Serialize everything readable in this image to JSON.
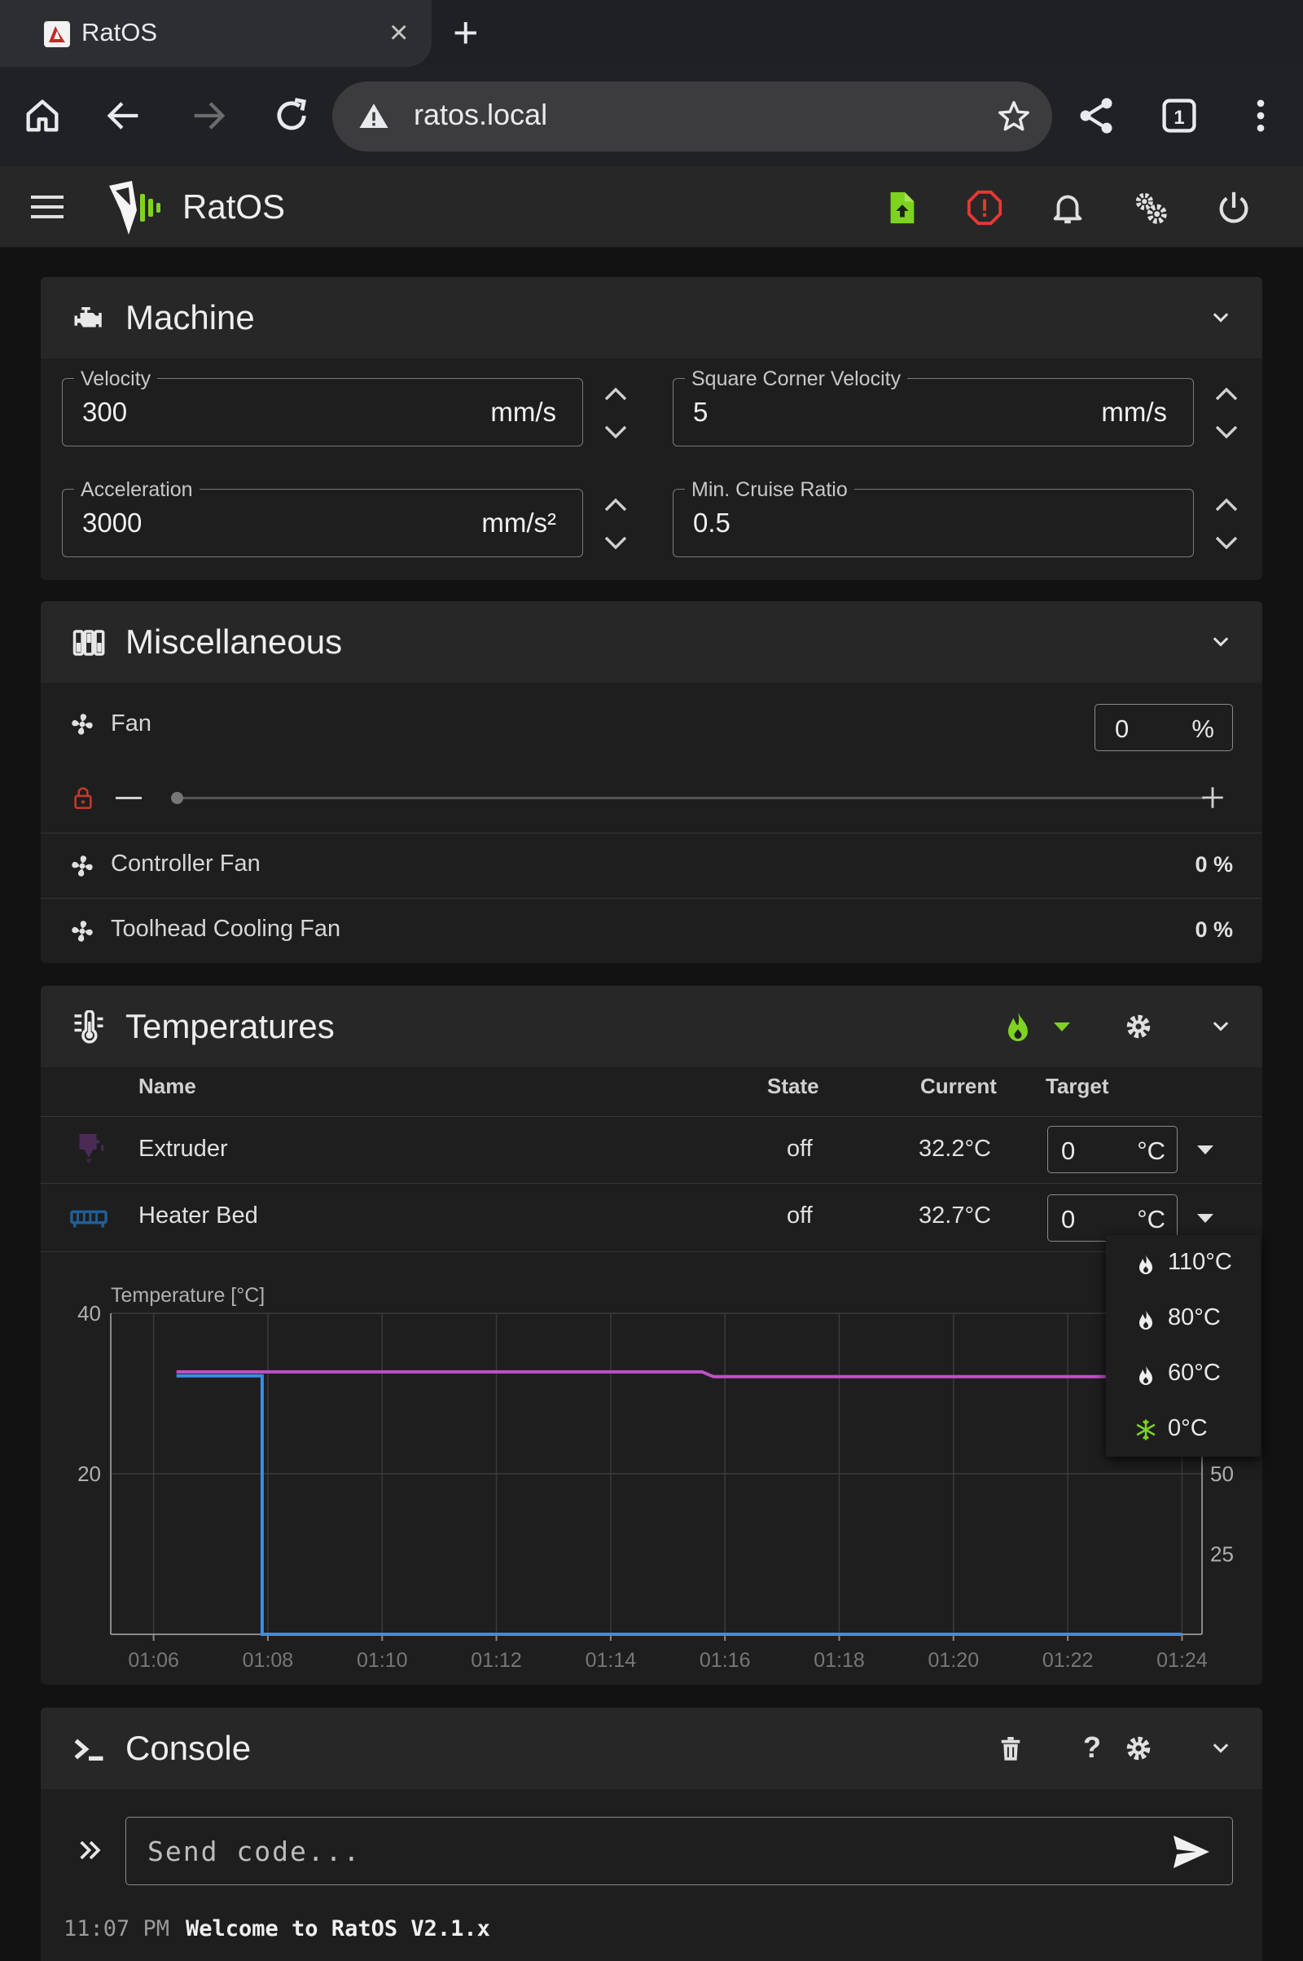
{
  "browser": {
    "tab_title": "RatOS",
    "url": "ratos.local"
  },
  "app": {
    "title": "RatOS",
    "colors": {
      "accent": "#7ed321",
      "error": "#e53935",
      "background": "#121212"
    }
  },
  "machine": {
    "title": "Machine",
    "fields": [
      {
        "label": "Velocity",
        "value": "300",
        "unit": "mm/s"
      },
      {
        "label": "Square Corner Velocity",
        "value": "5",
        "unit": "mm/s"
      },
      {
        "label": "Acceleration",
        "value": "3000",
        "unit": "mm/s²"
      },
      {
        "label": "Min. Cruise Ratio",
        "value": "0.5",
        "unit": ""
      }
    ]
  },
  "misc": {
    "title": "Miscellaneous",
    "fan": {
      "label": "Fan",
      "value": "0",
      "unit": "%",
      "level": 0
    },
    "rows": [
      {
        "label": "Controller Fan",
        "value": "0 %"
      },
      {
        "label": "Toolhead Cooling Fan",
        "value": "0 %"
      }
    ]
  },
  "temps": {
    "title": "Temperatures",
    "headers": {
      "name": "Name",
      "state": "State",
      "current": "Current",
      "target": "Target"
    },
    "rows": [
      {
        "name": "Extruder",
        "state": "off",
        "current": "32.2°C",
        "target": "0",
        "unit": "°C"
      },
      {
        "name": "Heater Bed",
        "state": "off",
        "current": "32.7°C",
        "target": "0",
        "unit": "°C"
      }
    ],
    "presets": [
      "110°C",
      "80°C",
      "60°C",
      "0°C"
    ]
  },
  "chart_data": {
    "type": "line",
    "ylabel": "Temperature [°C]",
    "x": [
      "01:06",
      "01:08",
      "01:10",
      "01:12",
      "01:14",
      "01:16",
      "01:18",
      "01:20",
      "01:22",
      "01:24"
    ],
    "y_ticks_left": [
      20,
      40
    ],
    "y_ticks_right": [
      25,
      50
    ],
    "ylim": [
      0,
      40
    ],
    "y2lim": [
      0,
      100
    ],
    "grid": true,
    "series": [
      {
        "color": "#c050c8",
        "points": [
          [
            "01:06.4",
            32.7
          ],
          [
            "01:15.6",
            32.7
          ],
          [
            "01:15.8",
            32.1
          ],
          [
            "01:24.0",
            32.1
          ]
        ]
      },
      {
        "color": "#3a8ee6",
        "points": [
          [
            "01:06.4",
            32.2
          ],
          [
            "01:07.9",
            32.2
          ],
          [
            "01:07.9",
            0
          ],
          [
            "01:24.0",
            0
          ]
        ]
      }
    ]
  },
  "console": {
    "title": "Console",
    "placeholder": "Send code...",
    "lines": [
      {
        "time": "11:07 PM",
        "message": "Welcome to RatOS V2.1.x"
      }
    ]
  }
}
